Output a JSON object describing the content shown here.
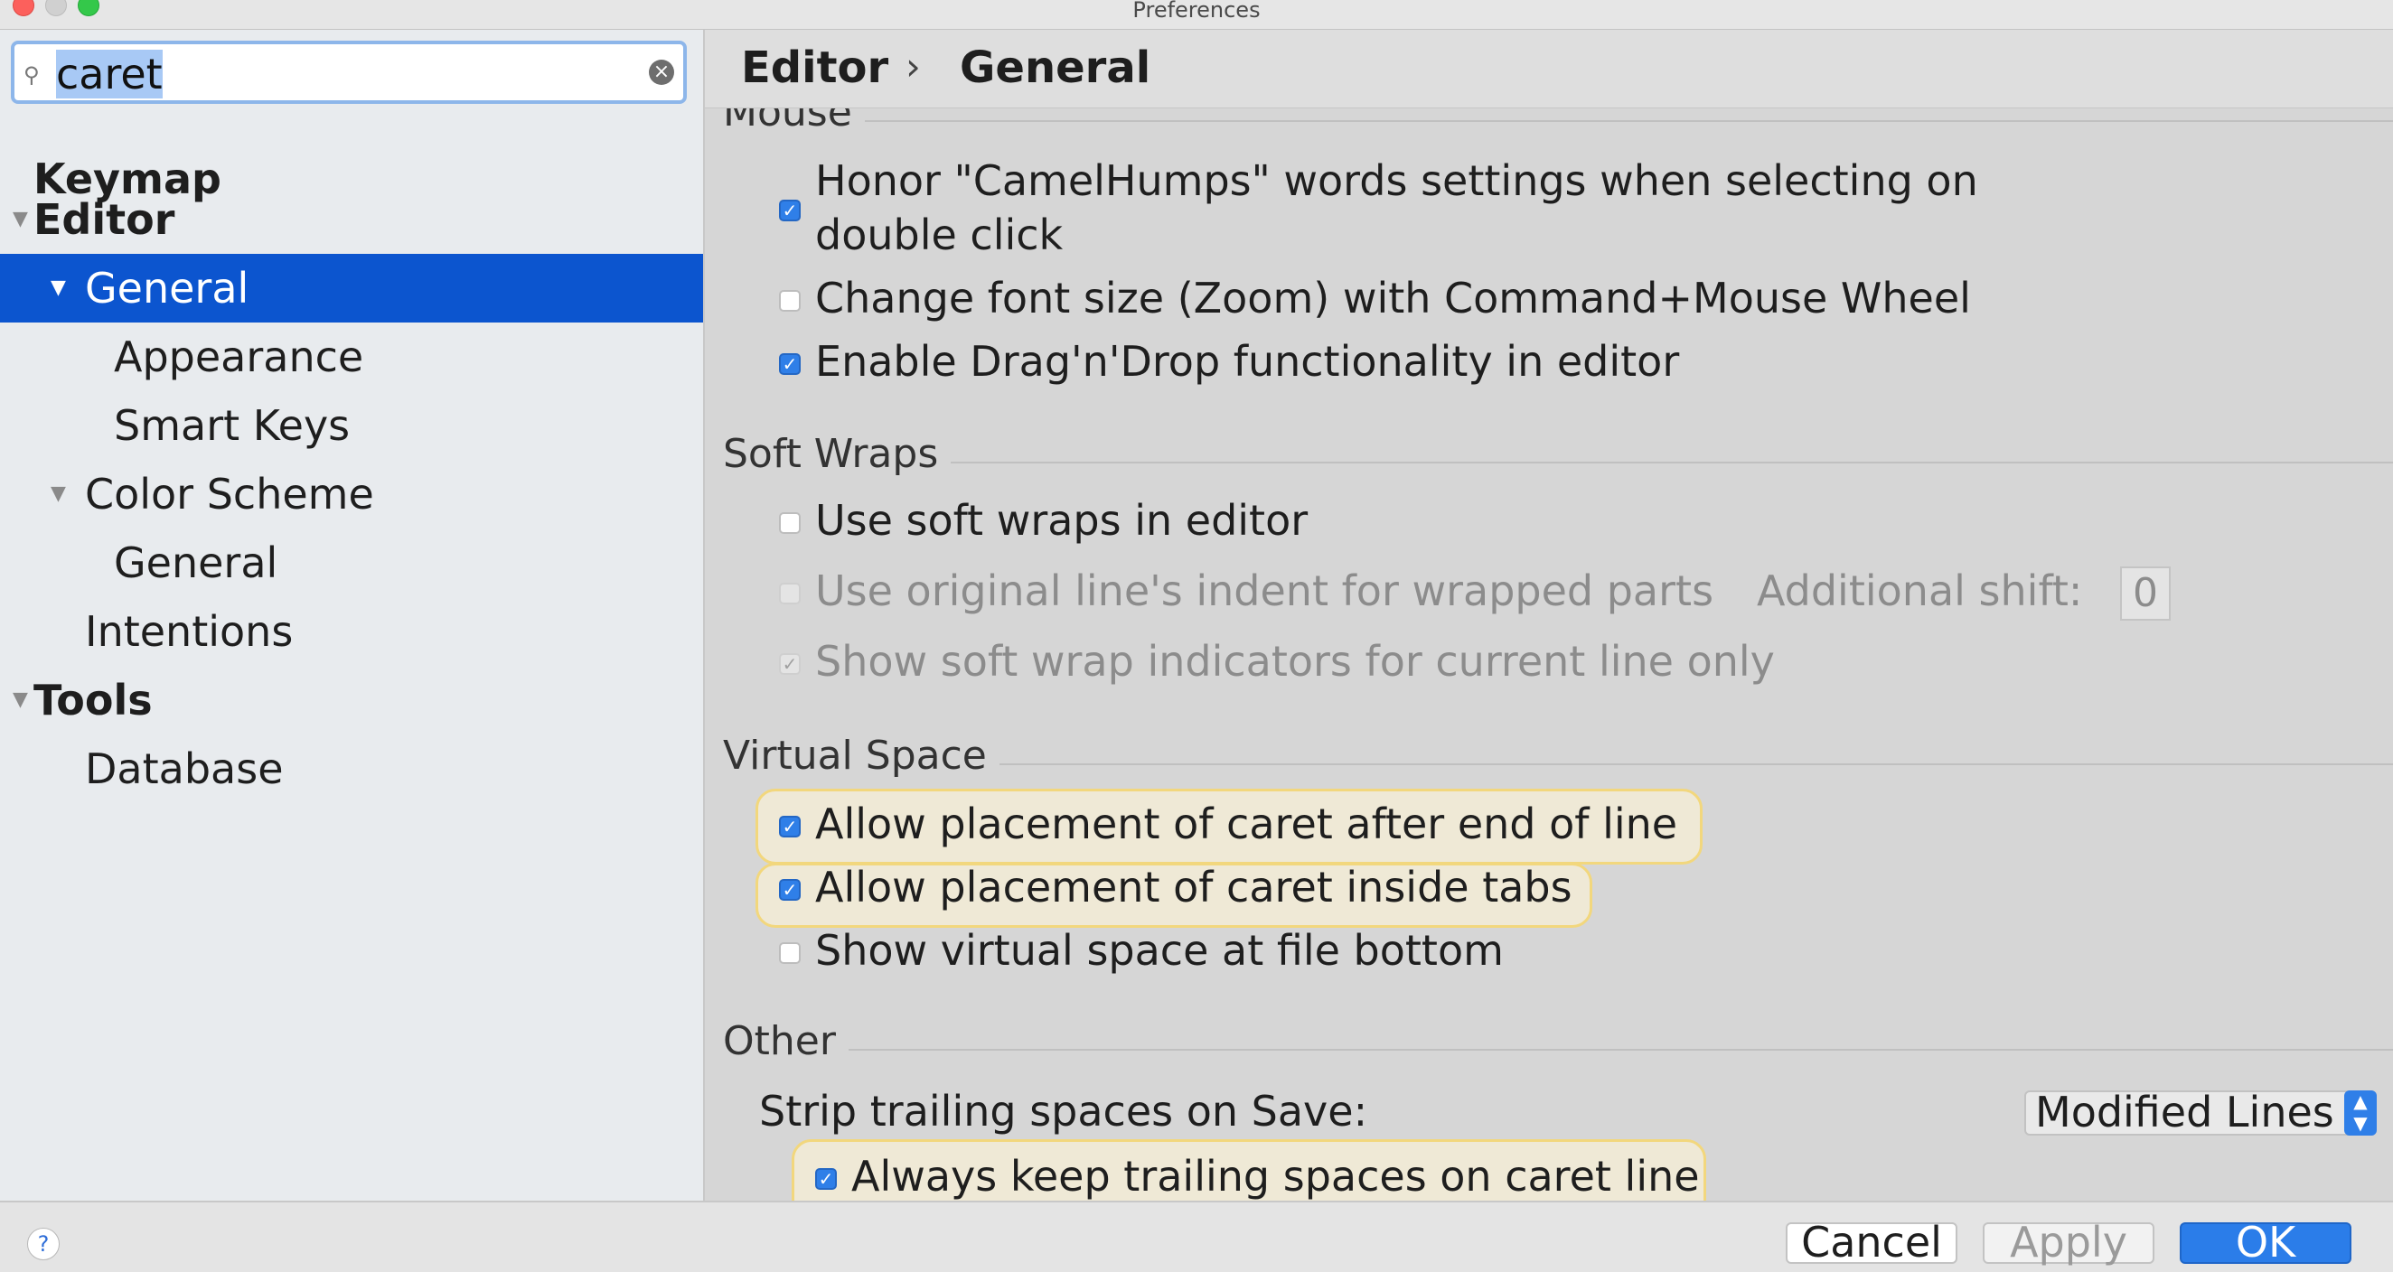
{
  "window": {
    "title": "Preferences"
  },
  "search": {
    "value": "caret"
  },
  "sidebar": {
    "items": [
      {
        "label": "Keymap"
      },
      {
        "label": "Editor"
      },
      {
        "label": "General"
      },
      {
        "label": "Appearance"
      },
      {
        "label": "Smart Keys"
      },
      {
        "label": "Color Scheme"
      },
      {
        "label": "General"
      },
      {
        "label": "Intentions"
      },
      {
        "label": "Tools"
      },
      {
        "label": "Database"
      }
    ]
  },
  "breadcrumb": {
    "first": "Editor",
    "second": "General"
  },
  "sections": {
    "mouse": {
      "title": "Mouse",
      "options": [
        {
          "label_line1": "Honor \"CamelHumps\" words settings when selecting on",
          "label_line2": "double click",
          "checked": true
        },
        {
          "label": "Change font size (Zoom) with Command+Mouse Wheel",
          "checked": false
        },
        {
          "label": "Enable Drag'n'Drop functionality in editor",
          "checked": true
        }
      ]
    },
    "soft_wraps": {
      "title": "Soft Wraps",
      "options": [
        {
          "label": "Use soft wraps in editor",
          "checked": false
        },
        {
          "label": "Use original line's indent for wrapped parts",
          "checked": false,
          "disabled": true
        },
        {
          "label": "Show soft wrap indicators for current line only",
          "checked": true,
          "disabled": true
        }
      ],
      "additional_shift_label": "Additional shift:",
      "additional_shift_value": "0"
    },
    "virtual_space": {
      "title": "Virtual Space",
      "options": [
        {
          "label": "Allow placement of caret after end of line",
          "checked": true,
          "highlighted": true
        },
        {
          "label": "Allow placement of caret inside tabs",
          "checked": true,
          "highlighted": true
        },
        {
          "label": "Show virtual space at file bottom",
          "checked": false
        }
      ]
    },
    "other": {
      "title": "Other",
      "strip_label": "Strip trailing spaces on Save:",
      "strip_value": "Modified Lines",
      "keep_trailing": {
        "label": "Always keep trailing spaces on caret line",
        "checked": true,
        "highlighted": true
      }
    }
  },
  "footer": {
    "cancel_label": "Cancel",
    "apply_label": "Apply",
    "ok_label": "OK",
    "help_label": "?"
  },
  "colors": {
    "selection": "#0c55cf",
    "highlight_border": "#f2d77d",
    "checkbox_on": "#2f7fe8",
    "ok_button": "#2b7de9"
  }
}
